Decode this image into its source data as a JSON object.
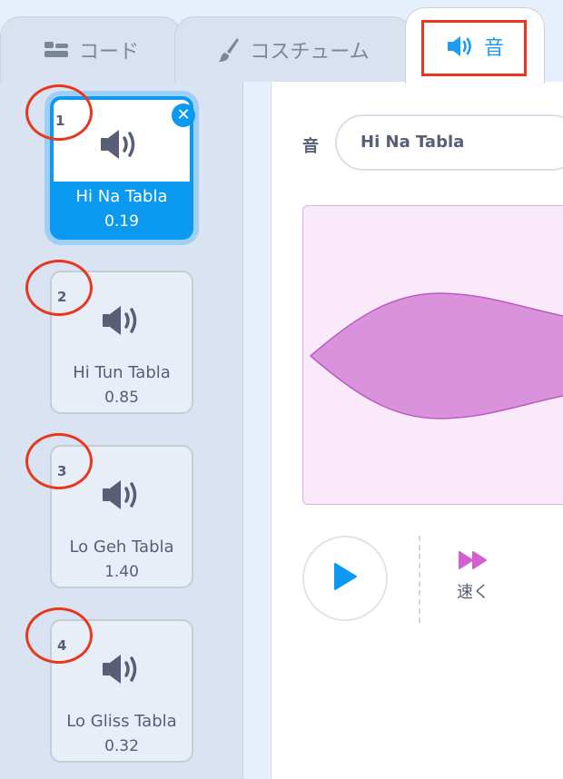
{
  "tabs": {
    "code": "コード",
    "costumes": "コスチューム",
    "sounds": "音"
  },
  "sounds": [
    {
      "number": "1",
      "name": "Hi Na Tabla",
      "duration": "0.19"
    },
    {
      "number": "2",
      "name": "Hi Tun Tabla",
      "duration": "0.85"
    },
    {
      "number": "3",
      "name": "Lo Geh Tabla",
      "duration": "1.40"
    },
    {
      "number": "4",
      "name": "Lo Gliss Tabla",
      "duration": "0.32"
    }
  ],
  "editor": {
    "name_label": "音",
    "name_value": "Hi Na Tabla",
    "effects": {
      "faster": "速く"
    }
  },
  "colors": {
    "accent": "#0c9af0",
    "annotation": "#e8361f",
    "waveform": "#db92dc"
  }
}
